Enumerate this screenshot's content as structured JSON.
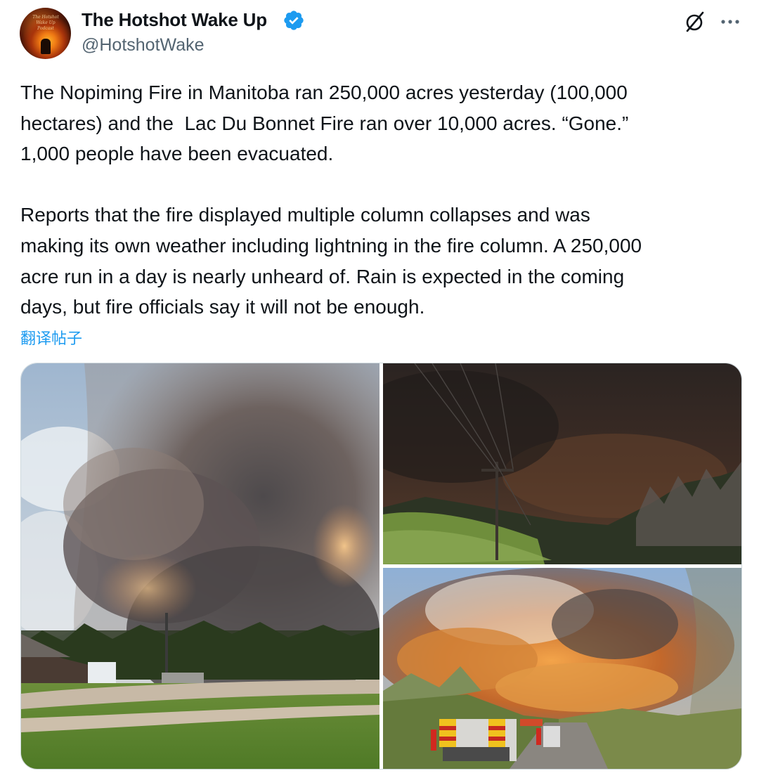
{
  "author": {
    "display_name": "The Hotshot Wake Up",
    "handle": "@HotshotWake",
    "avatar_text": "The Hotshot Wake Up Podcast",
    "verified": true,
    "verified_color": "#1d9bf0"
  },
  "header_actions": {
    "grok_icon": "grok-icon",
    "more_icon": "more-dots-icon"
  },
  "tweet": {
    "paragraphs": [
      "The Nopiming Fire in Manitoba ran 250,000 acres yesterday (100,000\nhectares) and the  Lac Du Bonnet Fire ran over 10,000 acres. “Gone.”\n1,000 people have been evacuated.",
      "Reports that the fire displayed multiple column collapses and was\nmaking its own weather including lightning in the fire column. A 250,000\nacre run in a day is nearly unheard of. Rain is expected in the coming\ndays, but fire officials say it will not be enough."
    ],
    "translate_label": "翻译帖子"
  },
  "media": {
    "photos": [
      {
        "scene": "smoke-column-over-rural-lodge"
      },
      {
        "scene": "dark-smoke-over-power-lines"
      },
      {
        "scene": "fire-trucks-on-road-before-flames"
      }
    ]
  },
  "colors": {
    "text": "#0f1419",
    "secondary": "#536471",
    "link": "#1d9bf0",
    "border": "#cfd9de"
  }
}
